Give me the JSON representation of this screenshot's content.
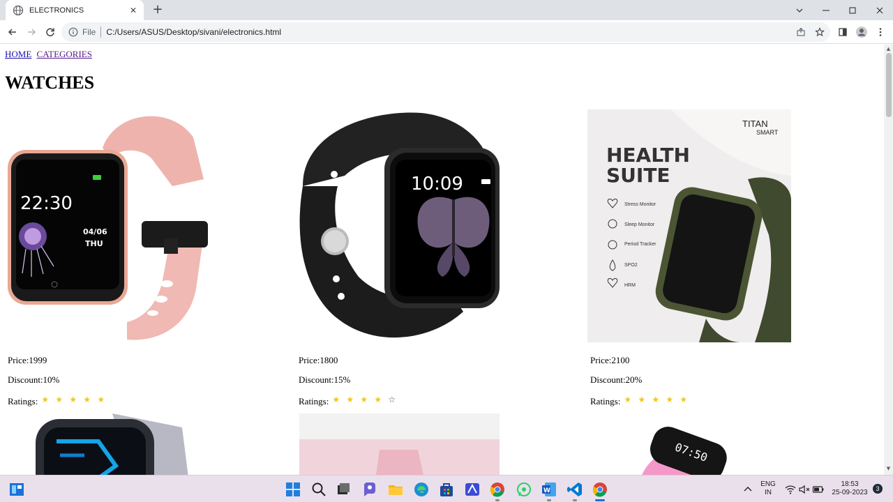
{
  "browser": {
    "tab_title": "ELECTRONICS",
    "tab_close": "✕",
    "new_tab": "+",
    "address_scheme": "File",
    "address_url": "C:/Users/ASUS/Desktop/sivani/electronics.html"
  },
  "page": {
    "nav": [
      {
        "label": "HOME"
      },
      {
        "label": "CATEGORIES"
      }
    ],
    "title": "WATCHES",
    "products": [
      {
        "price": "Price:1999",
        "discount": "Discount:10%",
        "ratings_label": "Ratings:",
        "rating": 5,
        "color": "#f4c7c3"
      },
      {
        "price": "Price:1800",
        "discount": "Discount:15%",
        "ratings_label": "Ratings:",
        "rating": 4,
        "color": "#1a1a1a"
      },
      {
        "price": "Price:2100",
        "discount": "Discount:20%",
        "ratings_label": "Ratings:",
        "rating": 5,
        "color": "#3f4a2e"
      }
    ],
    "promo": {
      "brand": "TITAN",
      "brand_sub": "SMART",
      "headline_1": "HEALTH",
      "headline_2": "SUITE",
      "features": [
        "Stress Monitor",
        "Sleep Monitor",
        "Period Tracker",
        "SPO2",
        "HRM"
      ]
    },
    "watch_faces": {
      "pink_time": "22:30",
      "pink_date": "04/06",
      "pink_day": "THU",
      "black_time": "10:09"
    }
  },
  "taskbar": {
    "lang_1": "ENG",
    "lang_2": "IN",
    "time": "18:53",
    "date": "25-09-2023",
    "notifications": "3"
  },
  "colors": {
    "star_filled": "#f5c518",
    "link": "#1a0dab",
    "visited_link": "#551a8b"
  }
}
